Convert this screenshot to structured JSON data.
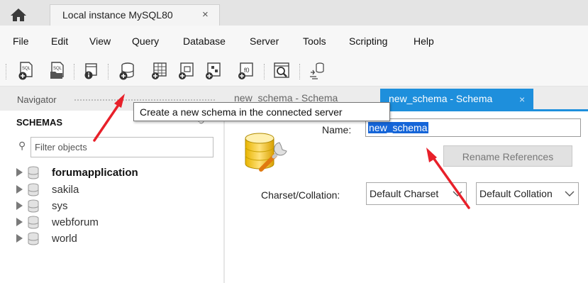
{
  "instance_tab": {
    "label": "Local instance MySQL80",
    "close_glyph": "×"
  },
  "menu": [
    "File",
    "Edit",
    "View",
    "Query",
    "Database",
    "Server",
    "Tools",
    "Scripting",
    "Help"
  ],
  "toolbar_icons": [
    "new-sql-tab-icon",
    "open-sql-script-icon",
    "inspect-object-icon",
    "create-schema-icon",
    "create-table-icon",
    "create-view-icon",
    "create-procedure-icon",
    "create-function-icon",
    "search-table-data-icon",
    "reconnect-icon"
  ],
  "tooltip": "Create a new schema in the connected server",
  "navigator": {
    "label": "Navigator",
    "schemas_title": "SCHEMAS",
    "filter_placeholder": "Filter objects",
    "schemas": [
      {
        "name": "forumapplication",
        "active": true
      },
      {
        "name": "sakila",
        "active": false
      },
      {
        "name": "sys",
        "active": false
      },
      {
        "name": "webforum",
        "active": false
      },
      {
        "name": "world",
        "active": false
      }
    ]
  },
  "editor_tabs": [
    {
      "label": "new_schema - Schema",
      "active": false
    },
    {
      "label": "new_schema - Schema",
      "active": true,
      "close_glyph": "×"
    }
  ],
  "schema_editor": {
    "name_label": "Name:",
    "name_value": "new_schema",
    "rename_button": "Rename References",
    "charset_label": "Charset/Collation:",
    "charset_value": "Default Charset",
    "collation_value": "Default Collation"
  },
  "colors": {
    "active_tab": "#1e8fdc",
    "selection": "#1565d8",
    "annotation_arrow": "#e8202a"
  }
}
